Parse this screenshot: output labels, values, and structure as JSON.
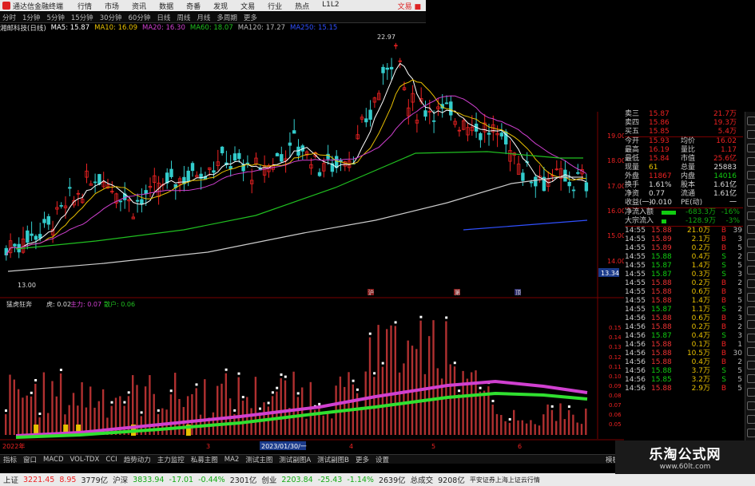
{
  "titlebar": {
    "app_title": "通达信金融终端",
    "menu": [
      "行情",
      "市场",
      "资讯",
      "数据",
      "奇番",
      "发现",
      "文易",
      "行业",
      "热点",
      "L1L2"
    ],
    "right": "文易 ■"
  },
  "period_tabs": [
    "分时",
    "1分钟",
    "5分钟",
    "15分钟",
    "30分钟",
    "60分钟",
    "日线",
    "周线",
    "月线",
    "多周期",
    "更多"
  ],
  "ma_header": {
    "stock": "湘邮科技(日线)",
    "ma5": "MA5: 15.87",
    "ma10": "MA10: 16.09",
    "ma20": "MA20: 16.30",
    "ma60": "MA60: 18.07",
    "ma120": "MA120: 17.27",
    "ma250": "MA250: 15.15",
    "colors": {
      "ma5": "#ffffff",
      "ma10": "#e8c000",
      "ma20": "#d040d0",
      "ma60": "#20c020",
      "ma120": "#bbbbbb",
      "ma250": "#3050ff"
    }
  },
  "price_chart": {
    "high_label": "22.97",
    "low_label": "13.00",
    "axis_ticks": [
      "19.00",
      "18.00",
      "17.00",
      "16.00",
      "15.00",
      "14.00"
    ],
    "current_price_label": "13.34",
    "event_markers": [
      "沪",
      "第",
      "顶"
    ]
  },
  "indicator": {
    "header": "猛虎狂奔",
    "tiger": "虎: 0.02",
    "main": "主力: 0.07",
    "retail": "散户: 0.06",
    "axis_ticks": [
      "0.15",
      "0.14",
      "0.13",
      "0.12",
      "0.11",
      "0.10",
      "0.09",
      "0.08",
      "0.07",
      "0.06",
      "0.05"
    ]
  },
  "date_axis": {
    "left": "2022年",
    "highlight": "2023/01/30/一",
    "ticks": [
      "3",
      "4",
      "5",
      "6"
    ]
  },
  "quote_panel": {
    "rows": [
      {
        "l1": "卖三",
        "v1": "15.87",
        "l2": "",
        "v2": "21.7万"
      },
      {
        "l1": "卖四",
        "v1": "15.86",
        "l2": "",
        "v2": "19.3万"
      },
      {
        "l1": "买五",
        "v1": "15.85",
        "l2": "",
        "v2": "5.4万"
      },
      {
        "l1": "今开",
        "v1": "15.93",
        "l2": "均价",
        "v2": "16.02"
      },
      {
        "l1": "最高",
        "v1": "16.19",
        "l2": "量比",
        "v2": "1.17"
      },
      {
        "l1": "最低",
        "v1": "15.84",
        "l2": "市值",
        "v2": "25.6亿"
      },
      {
        "l1": "现量",
        "v1": "61",
        "l2": "总量",
        "v2": "25883"
      },
      {
        "l1": "外盘",
        "v1": "11867",
        "l2": "内盘",
        "v2": "14016"
      },
      {
        "l1": "换手",
        "v1": "1.61%",
        "l2": "股本",
        "v2": "1.61亿"
      },
      {
        "l1": "净资",
        "v1": "0.77",
        "l2": "流通",
        "v2": "1.61亿"
      },
      {
        "l1": "收益(一)",
        "v1": "-0.010",
        "l2": "PE(动)",
        "v2": "一"
      }
    ],
    "flows": [
      {
        "label": "净流入额",
        "value": "-683.3万",
        "pct": "-16%"
      },
      {
        "label": "大宗流入",
        "value": "-128.9万",
        "pct": "-3%"
      }
    ]
  },
  "ticks": [
    {
      "t": "14:55",
      "p": "15.88",
      "v": "21.0万",
      "bs": "B",
      "n": "39"
    },
    {
      "t": "14:55",
      "p": "15.89",
      "v": "2.1万",
      "bs": "B",
      "n": "3"
    },
    {
      "t": "14:55",
      "p": "15.89",
      "v": "0.2万",
      "bs": "B",
      "n": "5"
    },
    {
      "t": "14:55",
      "p": "15.88",
      "v": "0.4万",
      "bs": "S",
      "n": "2"
    },
    {
      "t": "14:55",
      "p": "15.87",
      "v": "1.4万",
      "bs": "S",
      "n": "5"
    },
    {
      "t": "14:55",
      "p": "15.87",
      "v": "0.3万",
      "bs": "S",
      "n": "3"
    },
    {
      "t": "14:55",
      "p": "15.88",
      "v": "0.2万",
      "bs": "B",
      "n": "2"
    },
    {
      "t": "14:55",
      "p": "15.88",
      "v": "0.6万",
      "bs": "B",
      "n": "3"
    },
    {
      "t": "14:55",
      "p": "15.88",
      "v": "1.4万",
      "bs": "B",
      "n": "5"
    },
    {
      "t": "14:55",
      "p": "15.87",
      "v": "1.1万",
      "bs": "S",
      "n": "2"
    },
    {
      "t": "14:56",
      "p": "15.88",
      "v": "0.6万",
      "bs": "B",
      "n": "3"
    },
    {
      "t": "14:56",
      "p": "15.88",
      "v": "0.2万",
      "bs": "B",
      "n": "2"
    },
    {
      "t": "14:56",
      "p": "15.87",
      "v": "0.4万",
      "bs": "S",
      "n": "3"
    },
    {
      "t": "14:56",
      "p": "15.88",
      "v": "0.1万",
      "bs": "B",
      "n": "1"
    },
    {
      "t": "14:56",
      "p": "15.88",
      "v": "10.5万",
      "bs": "B",
      "n": "30"
    },
    {
      "t": "14:56",
      "p": "15.88",
      "v": "0.4万",
      "bs": "B",
      "n": "2"
    },
    {
      "t": "14:56",
      "p": "15.88",
      "v": "3.7万",
      "bs": "S",
      "n": "5"
    },
    {
      "t": "14:56",
      "p": "15.85",
      "v": "3.2万",
      "bs": "S",
      "n": "5"
    },
    {
      "t": "14:56",
      "p": "15.88",
      "v": "2.9万",
      "bs": "B",
      "n": "5"
    }
  ],
  "bottom_tabs": [
    "指标",
    "窗口",
    "MACD",
    "VOL-TDX",
    "CCI",
    "趋势动力",
    "主力监控",
    "私募主图",
    "MA2",
    "测试主图",
    "测试副图A",
    "测试副图B",
    "更多",
    "设置"
  ],
  "bottom_right": "模板",
  "status": {
    "sh_label": "上证",
    "sh_value": "3221.45",
    "sh_chg": "8.95",
    "sh_amt": "3779亿",
    "hs_label": "沪深",
    "hs_value": "3833.94",
    "hs_chg": "-17.01",
    "hs_pct": "-0.44%",
    "hs_amt": "2301亿",
    "cy_label": "创业",
    "cy_value": "2203.84",
    "cy_chg": "-25.43",
    "cy_pct": "-1.14%",
    "cy_amt": "2639亿",
    "total_label": "总成交",
    "total_value": "9208亿",
    "broker": "平安证券上海上证云行情"
  },
  "watermark": {
    "title": "乐淘公式网",
    "url": "www.60lt.com"
  }
}
